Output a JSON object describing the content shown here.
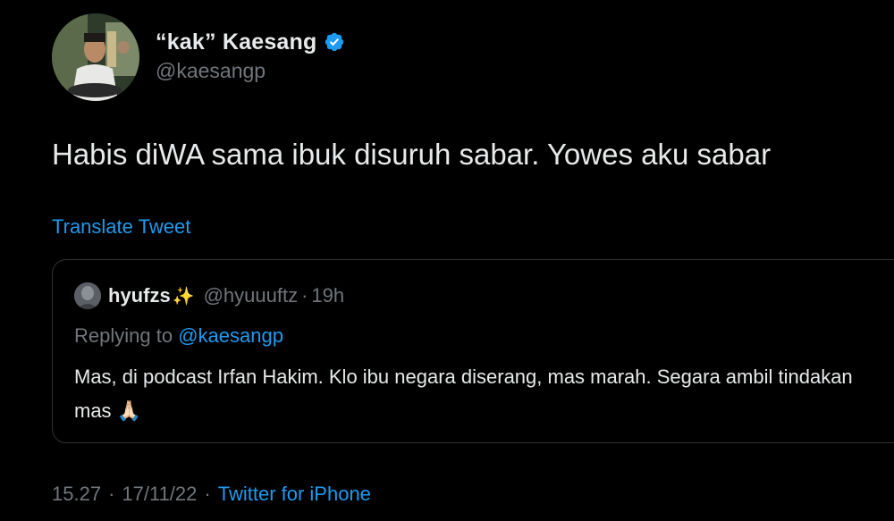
{
  "author": {
    "display_name": "“kak” Kaesang",
    "handle": "@kaesangp",
    "verified": true,
    "verified_icon": "verified-badge-icon",
    "verified_color": "#1d9bf0"
  },
  "tweet": {
    "text": "Habis diWA sama ibuk disuruh sabar. Yowes aku sabar",
    "translate_label": "Translate Tweet"
  },
  "quoted": {
    "display_name": "hyufzs",
    "name_emoji": "✨",
    "handle": "@hyuuuftz",
    "separator": "·",
    "time": "19h",
    "replying_prefix": "Replying to",
    "replying_mention": "@kaesangp",
    "text": "Mas, di podcast Irfan Hakim. Klo ibu negara diserang, mas marah. Segara ambil tindakan mas",
    "text_emoji": "🙏🏻"
  },
  "meta": {
    "time": "15.27",
    "separator1": "·",
    "date": "17/11/22",
    "separator2": "·",
    "source": "Twitter for iPhone"
  },
  "colors": {
    "background": "#000000",
    "text_primary": "#e7e9ea",
    "text_secondary": "#71767b",
    "accent": "#1d9bf0",
    "border": "#2f3336"
  }
}
